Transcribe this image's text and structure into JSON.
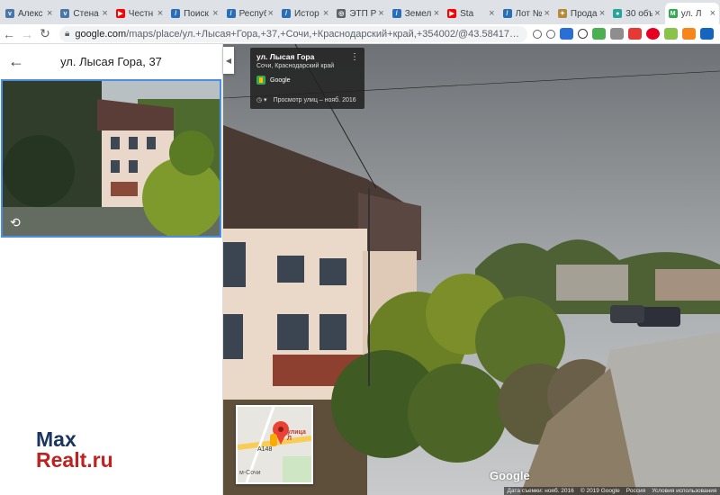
{
  "browser": {
    "tabs": [
      {
        "title": "Алекс",
        "favicon": "vk-icon",
        "color": "#4a76a8",
        "glyph": "v"
      },
      {
        "title": "Стена",
        "favicon": "vk-icon",
        "color": "#4a76a8",
        "glyph": "v"
      },
      {
        "title": "Честн",
        "favicon": "youtube-icon",
        "color": "#ff0000",
        "glyph": "▶"
      },
      {
        "title": "Поиск",
        "favicon": "torgi-icon",
        "color": "#2a6fb6",
        "glyph": "/"
      },
      {
        "title": "Респуб",
        "favicon": "torgi-icon",
        "color": "#2a6fb6",
        "glyph": "/"
      },
      {
        "title": "Истор",
        "favicon": "torgi-icon",
        "color": "#2a6fb6",
        "glyph": "/"
      },
      {
        "title": "ЭТП Р",
        "favicon": "globe-icon",
        "color": "#5f6368",
        "glyph": "◎"
      },
      {
        "title": "Земел",
        "favicon": "torgi-icon",
        "color": "#2a6fb6",
        "glyph": "/"
      },
      {
        "title": "Sta",
        "favicon": "youtube-icon",
        "color": "#ff0000",
        "glyph": "▶"
      },
      {
        "title": "Лот №",
        "favicon": "torgi-icon",
        "color": "#2a6fb6",
        "glyph": "/"
      },
      {
        "title": "Прода",
        "favicon": "emblem-icon",
        "color": "#b58a3c",
        "glyph": "✦"
      },
      {
        "title": "30 объ",
        "favicon": "map-pin-icon",
        "color": "#26a69a",
        "glyph": "●"
      },
      {
        "title": "ул. Л",
        "favicon": "google-maps-icon",
        "color": "#34a853",
        "glyph": "M",
        "active": true
      }
    ],
    "url_host": "google.com",
    "url_path": "/maps/place/ул.+Лысая+Гора,+37,+Сочи,+Краснодарский+край,+354002/@43.5841751,39.7425334,3a,75..."
  },
  "panel": {
    "title": "ул. Лысая Гора, 37"
  },
  "streetview": {
    "card_title": "ул. Лысая Гора",
    "card_subtitle": "Сочи, Краснодарский край",
    "card_source": "Google",
    "card_history": "Просмотр улиц – нояб. 2016",
    "minimap_label": "улица Л",
    "minimap_road": "А148",
    "minimap_city": "м-Сочи",
    "google_logo": "Google",
    "footer": [
      "Дата съемки: нояб. 2016",
      "© 2019 Google",
      "Россия",
      "Условия использования"
    ]
  },
  "watermark": {
    "line1": "Max",
    "line2": "Realt.ru"
  }
}
